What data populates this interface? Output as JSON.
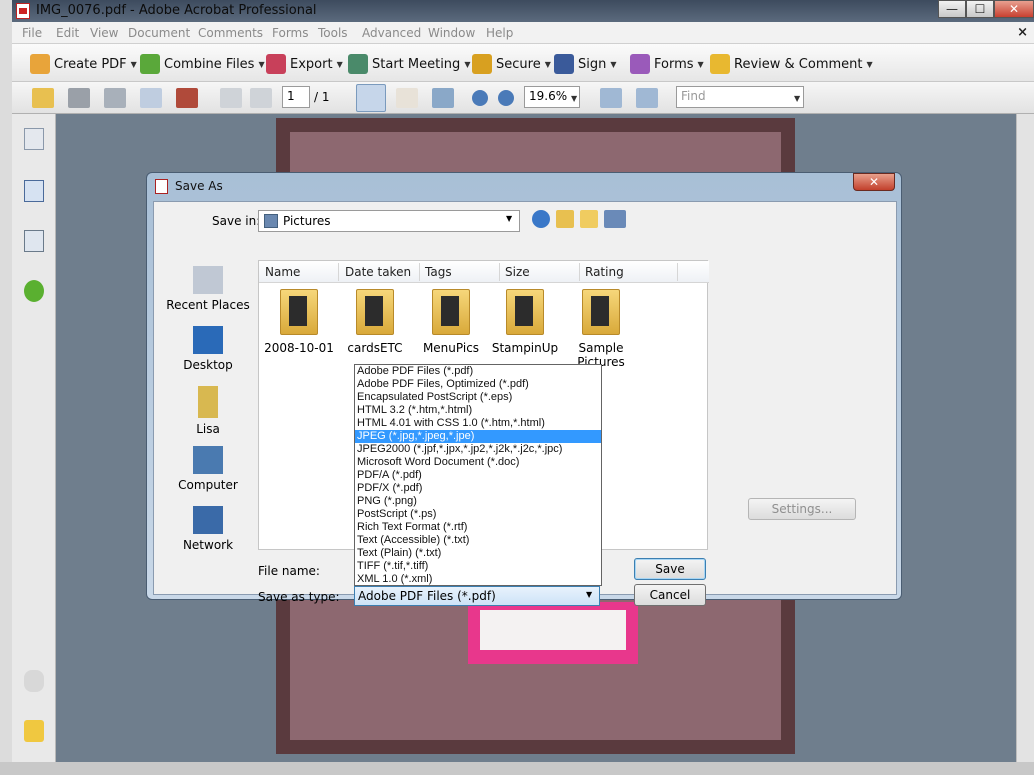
{
  "window": {
    "title": "IMG_0076.pdf - Adobe Acrobat Professional",
    "controls": {
      "minimize": "—",
      "maximize": "☐",
      "close": "✕"
    }
  },
  "menubar": {
    "items": [
      "File",
      "Edit",
      "View",
      "Document",
      "Comments",
      "Forms",
      "Tools",
      "Advanced",
      "Window",
      "Help"
    ],
    "close": "×"
  },
  "toolbar1": {
    "items": [
      {
        "label": "Create PDF",
        "icon": "create-pdf-icon",
        "color": "#e8a43a"
      },
      {
        "label": "Combine Files",
        "icon": "combine-files-icon",
        "color": "#5aa83a"
      },
      {
        "label": "Export",
        "icon": "export-icon",
        "color": "#c8405a"
      },
      {
        "label": "Start Meeting",
        "icon": "meeting-icon",
        "color": "#4a8a6a"
      },
      {
        "label": "Secure",
        "icon": "lock-icon",
        "color": "#d8a020"
      },
      {
        "label": "Sign",
        "icon": "pen-icon",
        "color": "#3a5a9a"
      },
      {
        "label": "Forms",
        "icon": "forms-icon",
        "color": "#9a5aba"
      },
      {
        "label": "Review & Comment",
        "icon": "comment-icon",
        "color": "#e8b830"
      }
    ]
  },
  "toolbar2": {
    "page_current": "1",
    "page_total": "/ 1",
    "zoom": "19.6%",
    "find_placeholder": "Find"
  },
  "dialog": {
    "title": "Save As",
    "close": "✕",
    "save_in_label": "Save in:",
    "save_in_value": "Pictures",
    "places": [
      "Recent Places",
      "Desktop",
      "Lisa",
      "Computer",
      "Network"
    ],
    "columns": [
      "Name",
      "Date taken",
      "Tags",
      "Size",
      "Rating"
    ],
    "folders": [
      "2008-10-01",
      "cardsETC",
      "MenuPics",
      "StampinUp",
      "Sample Pictures"
    ],
    "file_name_label": "File name:",
    "save_as_type_label": "Save as type:",
    "save_as_type_value": "Adobe PDF Files (*.pdf)",
    "file_types": [
      "Adobe PDF Files (*.pdf)",
      "Adobe PDF Files, Optimized (*.pdf)",
      "Encapsulated PostScript (*.eps)",
      "HTML 3.2 (*.htm,*.html)",
      "HTML 4.01 with CSS 1.0 (*.htm,*.html)",
      "JPEG (*.jpg,*.jpeg,*.jpe)",
      "JPEG2000 (*.jpf,*.jpx,*.jp2,*.j2k,*.j2c,*.jpc)",
      "Microsoft Word Document (*.doc)",
      "PDF/A (*.pdf)",
      "PDF/X (*.pdf)",
      "PNG (*.png)",
      "PostScript (*.ps)",
      "Rich Text Format (*.rtf)",
      "Text (Accessible) (*.txt)",
      "Text (Plain) (*.txt)",
      "TIFF (*.tif,*.tiff)",
      "XML 1.0 (*.xml)"
    ],
    "selected_type": "JPEG (*.jpg,*.jpeg,*.jpe)",
    "save_button": "Save",
    "cancel_button": "Cancel",
    "settings_button": "Settings..."
  },
  "colors": {
    "selection": "#3399ff",
    "doc_background": "#6f7e8d",
    "card_pink": "#e8378c"
  }
}
